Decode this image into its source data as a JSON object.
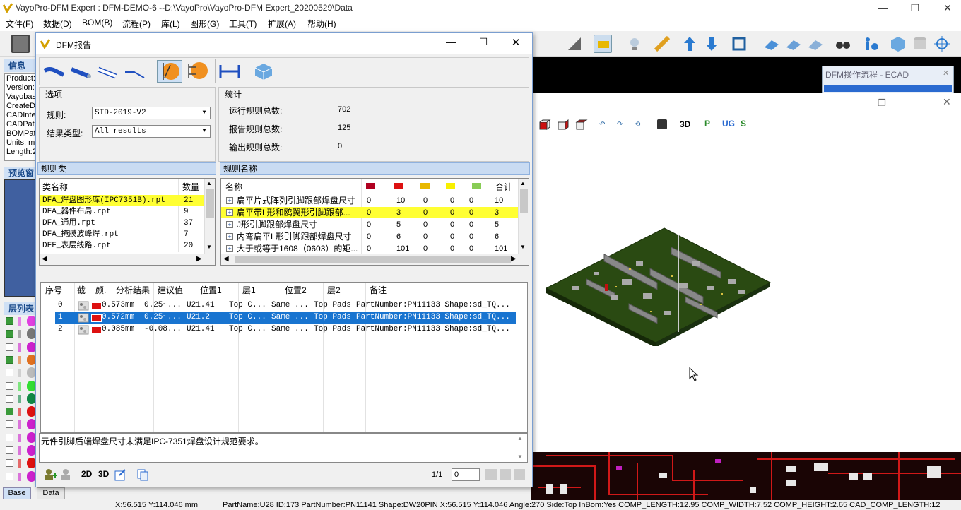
{
  "app": {
    "title": "VayoPro-DFM Expert : DFM-DEMO-6  --D:\\VayoPro\\VayoPro-DFM Expert_20200529\\Data"
  },
  "menu": [
    "文件(F)",
    "数据(D)",
    "BOM(B)",
    "流程(P)",
    "库(L)",
    "图形(G)",
    "工具(T)",
    "扩展(A)",
    "帮助(H)"
  ],
  "left": {
    "info_header": "信息",
    "info_lines": [
      "Product:",
      "Version:",
      "Vayobas",
      "CreateD",
      "CADInte",
      "CADPat",
      "BOMPat",
      "Units: m",
      "Length:2"
    ],
    "preview_header": "预览窗",
    "layers_header": "层列表",
    "layers": [
      {
        "checked": true,
        "color": "#e040e0"
      },
      {
        "checked": true,
        "color": "#777777"
      },
      {
        "checked": false,
        "color": "#cc22cc"
      },
      {
        "checked": true,
        "color": "#e07020"
      },
      {
        "checked": false,
        "color": "#bbbbbb"
      },
      {
        "checked": false,
        "color": "#33dd33"
      },
      {
        "checked": false,
        "color": "#118844"
      },
      {
        "checked": true,
        "color": "#dd1111"
      },
      {
        "checked": false,
        "color": "#cc22cc"
      },
      {
        "checked": false,
        "color": "#cc22cc"
      },
      {
        "checked": false,
        "color": "#cc22cc"
      },
      {
        "checked": false,
        "color": "#dd1111"
      },
      {
        "checked": false,
        "color": "#cc22cc"
      }
    ],
    "tabs": [
      "Base",
      "Data"
    ]
  },
  "ecad": {
    "title": "DFM操作流程 - ECAD"
  },
  "viewer": {
    "tb_labels": [
      "3D",
      "P",
      "UG",
      "S"
    ]
  },
  "dialog": {
    "title": "DFM报告",
    "options": {
      "header": "选项",
      "rule_label": "规则:",
      "rule_value": "STD-2019-V2",
      "type_label": "结果类型:",
      "type_value": "All results"
    },
    "stats": {
      "header": "统计",
      "rows": [
        {
          "label": "运行规则总数:",
          "value": "702"
        },
        {
          "label": "报告规则总数:",
          "value": "125"
        },
        {
          "label": "输出规则总数:",
          "value": "0"
        }
      ]
    },
    "cat_section": "规则类",
    "cat_headers": [
      "类名称",
      "数量"
    ],
    "categories": [
      {
        "name": "DFA_焊盘图形库(IPC7351B).rpt",
        "count": "21",
        "hl": true
      },
      {
        "name": "DFA_器件布局.rpt",
        "count": "9"
      },
      {
        "name": "DFA_通用.rpt",
        "count": "37"
      },
      {
        "name": "DFA_掩膜波峰焊.rpt",
        "count": "7"
      },
      {
        "name": "DFF_表层线路.rpt",
        "count": "20"
      }
    ],
    "rule_section": "规则名称",
    "rule_headers": {
      "name": "名称",
      "total": "合计",
      "colors": [
        "#b00020",
        "#dd1111",
        "#e8b800",
        "#f8f000",
        "#88cc55"
      ]
    },
    "rules": [
      {
        "name": "扁平片式阵列引脚跟部焊盘尺寸",
        "vals": [
          "0",
          "10",
          "0",
          "0",
          "0"
        ],
        "total": "10"
      },
      {
        "name": "扁平带L形和鸥翼形引脚跟部...",
        "vals": [
          "0",
          "3",
          "0",
          "0",
          "0"
        ],
        "total": "3",
        "hl": true
      },
      {
        "name": "J形引脚跟部焊盘尺寸",
        "vals": [
          "0",
          "5",
          "0",
          "0",
          "0"
        ],
        "total": "5"
      },
      {
        "name": "内弯扁平L形引脚跟部焊盘尺寸",
        "vals": [
          "0",
          "6",
          "0",
          "0",
          "0"
        ],
        "total": "6"
      },
      {
        "name": "大于或等于1608（0603）的矩...",
        "vals": [
          "0",
          "101",
          "0",
          "0",
          "0"
        ],
        "total": "101"
      }
    ],
    "res_headers": [
      "序号",
      "截",
      "颜.",
      "分析结果",
      "建议值",
      "位置1",
      "层1",
      "位置2",
      "层2",
      "备注"
    ],
    "results": [
      {
        "no": "0",
        "result": "0.573mm",
        "suggest": "0.25~...",
        "pos1": "U21.41",
        "layer1": "Top C...",
        "pos2": "Same ...",
        "layer2": "Top Pads",
        "note": "PartNumber:PN11133 Shape:sd_TQ...",
        "color": "#dd1111"
      },
      {
        "no": "1",
        "result": "0.572mm",
        "suggest": "0.25~...",
        "pos1": "U21.2",
        "layer1": "Top C...",
        "pos2": "Same ...",
        "layer2": "Top Pads",
        "note": "PartNumber:PN11133 Shape:sd_TQ...",
        "color": "#dd1111",
        "sel": true
      },
      {
        "no": "2",
        "result": "0.085mm",
        "suggest": "-0.08...",
        "pos1": "U21.41",
        "layer1": "Top C...",
        "pos2": "Same ...",
        "layer2": "Top Pads",
        "note": "PartNumber:PN11133 Shape:sd_TQ...",
        "color": "#dd1111"
      }
    ],
    "description": "元件引脚后端焊盘尺寸未满足IPC-7351焊盘设计规范要求。",
    "footer": {
      "btn_2d": "2D",
      "btn_3d": "3D",
      "page": "1/1",
      "page_input": "0"
    }
  },
  "status": {
    "coords": "X:56.515 Y:114.046 mm",
    "detail": "PartName:U28 ID:173 PartNumber:PN11141 Shape:DW20PIN X:56.515 Y:114.046 Angle:270 Side:Top InBom:Yes COMP_LENGTH:12.95 COMP_WIDTH:7.52 COMP_HEIGHT:2.65 CAD_COMP_LENGTH:12"
  }
}
